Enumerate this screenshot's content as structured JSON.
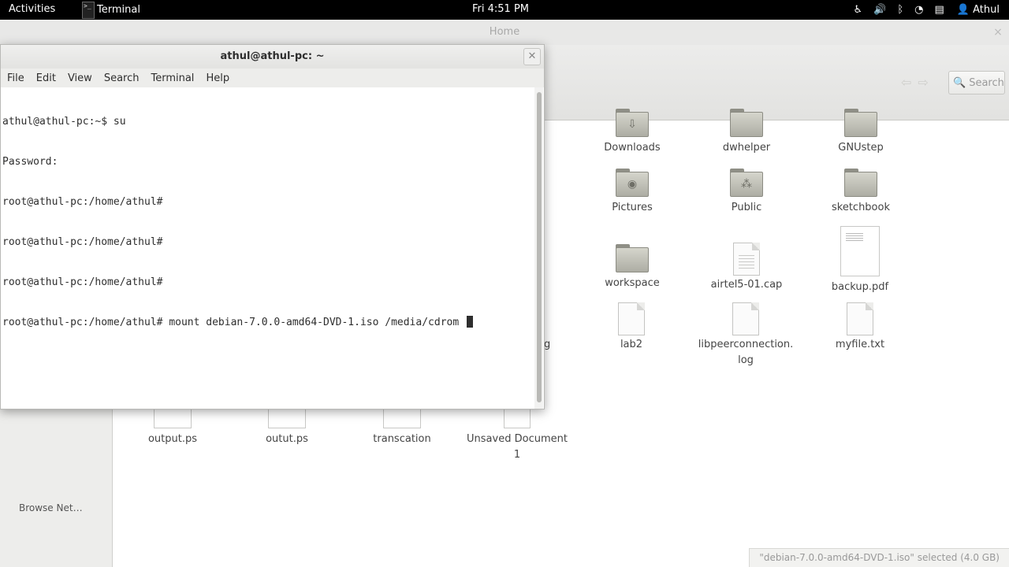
{
  "topbar": {
    "activities": "Activities",
    "app_name": "Terminal",
    "clock": "Fri  4:51 PM",
    "user": "Athul"
  },
  "files": {
    "title": "Home",
    "search_label": "Search",
    "sidebar_partial": "Browse Net…",
    "status": "\"debian-7.0.0-amd64-DVD-1.iso\" selected (4.0 GB)",
    "partial_label_g": "g",
    "items": {
      "downloads": "Downloads",
      "dwhelper": "dwhelper",
      "gnustep": "GNUstep",
      "pictures": "Pictures",
      "public": "Public",
      "sketchbook": "sketchbook",
      "workspace": "workspace",
      "airtel": "airtel5-01.cap",
      "backup": "backup.pdf",
      "lab2": "lab2",
      "libpeer": "libpeerconnection.",
      "libpeer2": "log",
      "myfile": "myfile.txt",
      "output": "output.ps",
      "outut": "outut.ps",
      "transcation": "transcation",
      "unsaved": "Unsaved Document",
      "unsaved2": "1"
    }
  },
  "terminal": {
    "title": "athul@athul-pc: ~",
    "menu": [
      "File",
      "Edit",
      "View",
      "Search",
      "Terminal",
      "Help"
    ],
    "lines": [
      "athul@athul-pc:~$ su",
      "Password:",
      "root@athul-pc:/home/athul#",
      "root@athul-pc:/home/athul#",
      "root@athul-pc:/home/athul#",
      "root@athul-pc:/home/athul# mount debian-7.0.0-amd64-DVD-1.iso /media/cdrom "
    ]
  },
  "icons": {
    "accessibility": "accessibility-icon",
    "volume": "volume-icon",
    "bluetooth": "bluetooth-icon",
    "wifi": "wifi-icon",
    "clipboard": "clipboard-icon",
    "user": "user-icon"
  }
}
